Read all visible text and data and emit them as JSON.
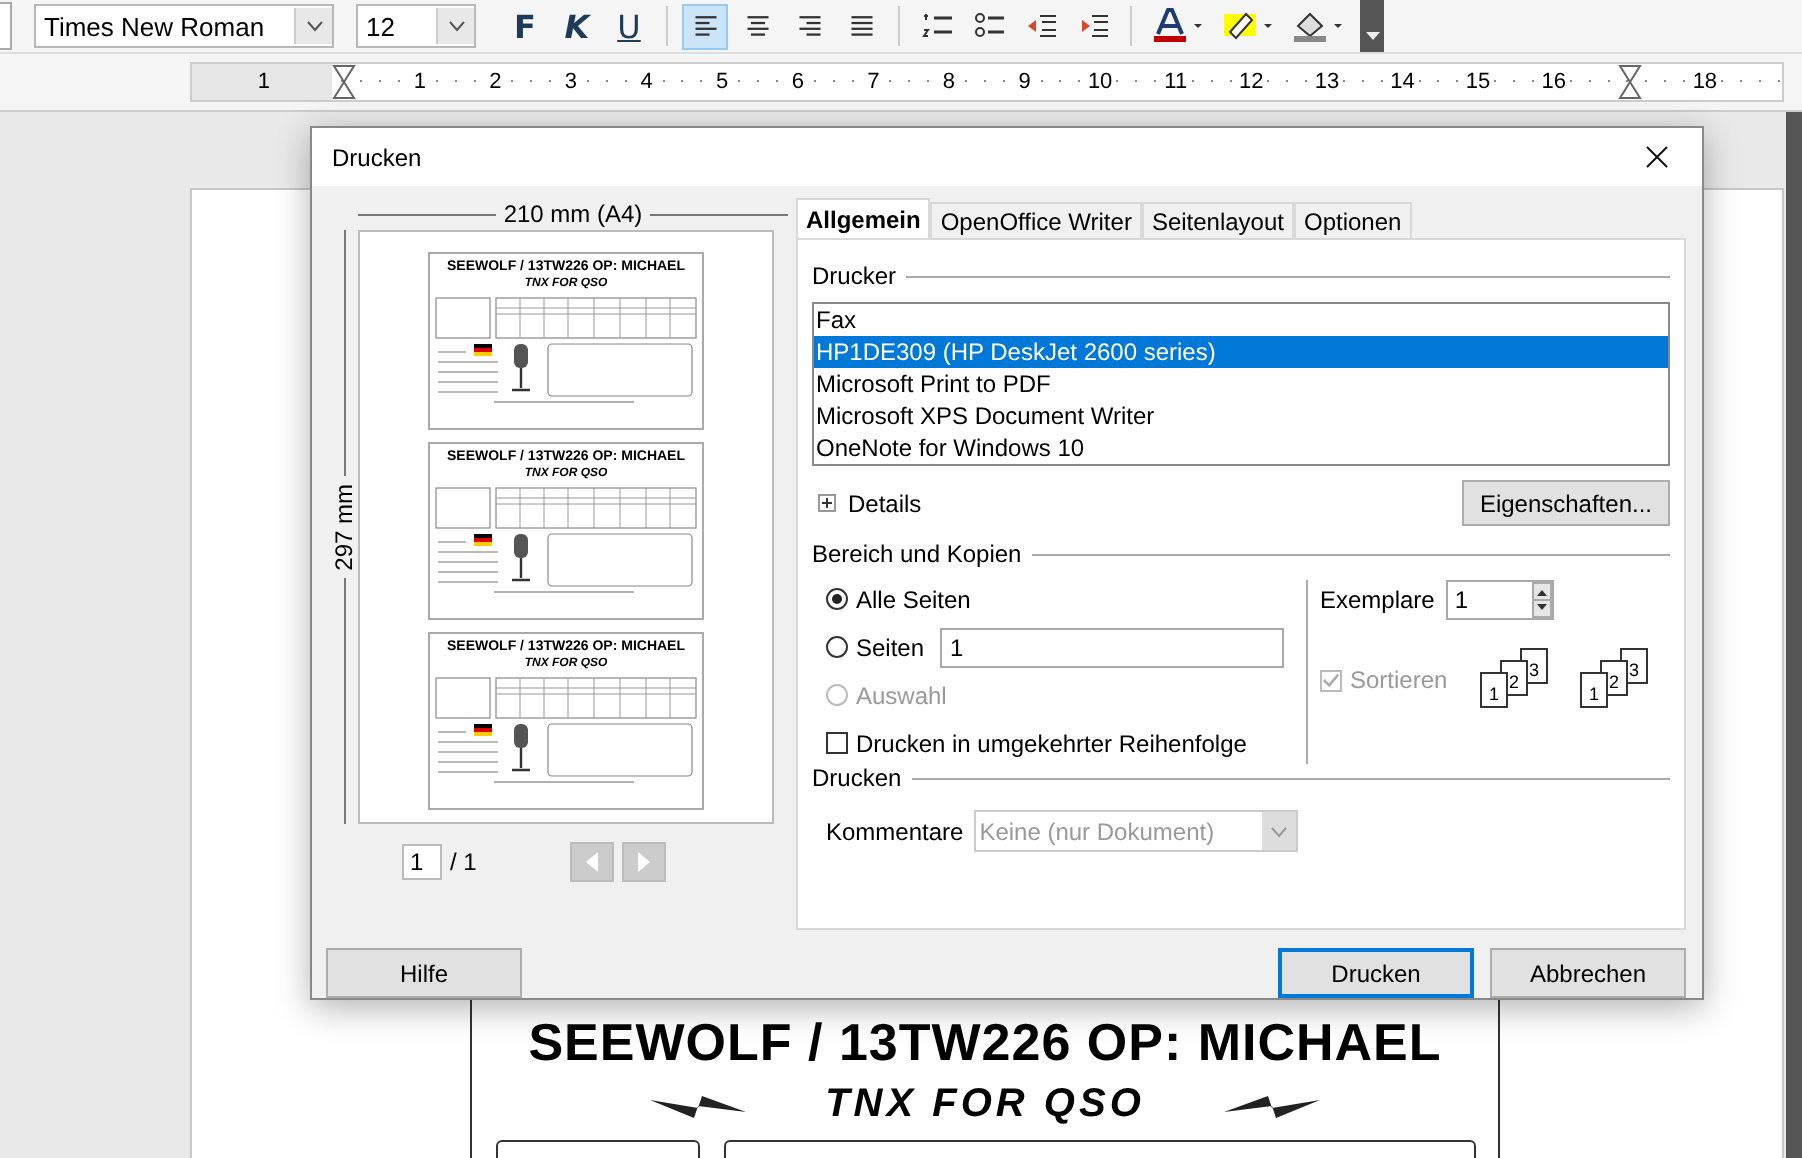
{
  "toolbar": {
    "font_name": "Times New Roman",
    "font_size": "12",
    "bold_label": "F",
    "italic_label": "K",
    "underline_label": "U",
    "alignment": [
      {
        "kind": "left",
        "selected": true
      },
      {
        "kind": "center",
        "selected": false
      },
      {
        "kind": "right",
        "selected": false
      },
      {
        "kind": "justify",
        "selected": false
      }
    ]
  },
  "ruler": {
    "left_label": "1",
    "marks": [
      {
        "kind": "number",
        "label": "1"
      },
      {
        "kind": "number",
        "label": "2"
      },
      {
        "kind": "number",
        "label": "3"
      },
      {
        "kind": "number",
        "label": "4"
      },
      {
        "kind": "number",
        "label": "5"
      },
      {
        "kind": "number",
        "label": "6"
      },
      {
        "kind": "number",
        "label": "7"
      },
      {
        "kind": "number",
        "label": "8"
      },
      {
        "kind": "number",
        "label": "9"
      },
      {
        "kind": "number",
        "label": "10"
      },
      {
        "kind": "number",
        "label": "11"
      },
      {
        "kind": "number",
        "label": "12"
      },
      {
        "kind": "number",
        "label": "13"
      },
      {
        "kind": "number",
        "label": "14"
      },
      {
        "kind": "number",
        "label": "15"
      },
      {
        "kind": "number",
        "label": "16"
      },
      {
        "kind": "indent-marker"
      },
      {
        "kind": "number",
        "label": "18"
      }
    ]
  },
  "document": {
    "title": "SEEWOLF / 13TW226  OP: MICHAEL",
    "subtitle": "TNX FOR QSO"
  },
  "dialog": {
    "title": "Drucken",
    "preview": {
      "width_label": "210 mm (A4)",
      "height_label": "297 mm",
      "page_value": "1",
      "page_total": "/ 1",
      "cards": [
        {
          "title": "SEEWOLF / 13TW226  OP: MICHAEL",
          "subtitle": "TNX FOR QSO"
        },
        {
          "title": "SEEWOLF / 13TW226  OP: MICHAEL",
          "subtitle": "TNX FOR QSO"
        },
        {
          "title": "SEEWOLF / 13TW226  OP: MICHAEL",
          "subtitle": "TNX FOR QSO"
        }
      ]
    },
    "tabs": [
      {
        "label": "Allgemein",
        "selected": true
      },
      {
        "label": "OpenOffice Writer",
        "selected": false
      },
      {
        "label": "Seitenlayout",
        "selected": false
      },
      {
        "label": "Optionen",
        "selected": false
      }
    ],
    "printer": {
      "heading": "Drucker",
      "printers": [
        {
          "name": "Fax",
          "selected": false
        },
        {
          "name": "HP1DE309 (HP DeskJet 2600 series)",
          "selected": true
        },
        {
          "name": "Microsoft Print to PDF",
          "selected": false
        },
        {
          "name": "Microsoft XPS Document Writer",
          "selected": false
        },
        {
          "name": "OneNote for Windows 10",
          "selected": false
        }
      ],
      "details": "Details",
      "expanded": false,
      "properties_button": "Eigenschaften..."
    },
    "range": {
      "heading": "Bereich und Kopien",
      "options": [
        {
          "label": "Alle Seiten",
          "selected": true,
          "disabled": false
        },
        {
          "label": "Seiten",
          "selected": false,
          "disabled": false,
          "value": "1"
        },
        {
          "label": "Auswahl",
          "selected": false,
          "disabled": true
        }
      ],
      "reverse": {
        "label": "Drucken in umgekehrter Reihenfolge",
        "checked": false
      },
      "copies": {
        "label": "Exemplare",
        "value": "1"
      },
      "collate": {
        "label": "Sortieren",
        "checked": true,
        "disabled": true
      },
      "collate_icons": [
        {
          "pages": [
            "1",
            "2",
            "3"
          ]
        },
        {
          "pages": [
            "1",
            "2",
            "3"
          ]
        }
      ]
    },
    "print": {
      "heading": "Drucken",
      "comments_label": "Kommentare",
      "comments_value": "Keine (nur Dokument)",
      "disabled": true
    },
    "buttons": [
      {
        "label": "Hilfe",
        "default": false
      },
      {
        "label": "Drucken",
        "default": true
      },
      {
        "label": "Abbrechen",
        "default": false
      }
    ]
  }
}
